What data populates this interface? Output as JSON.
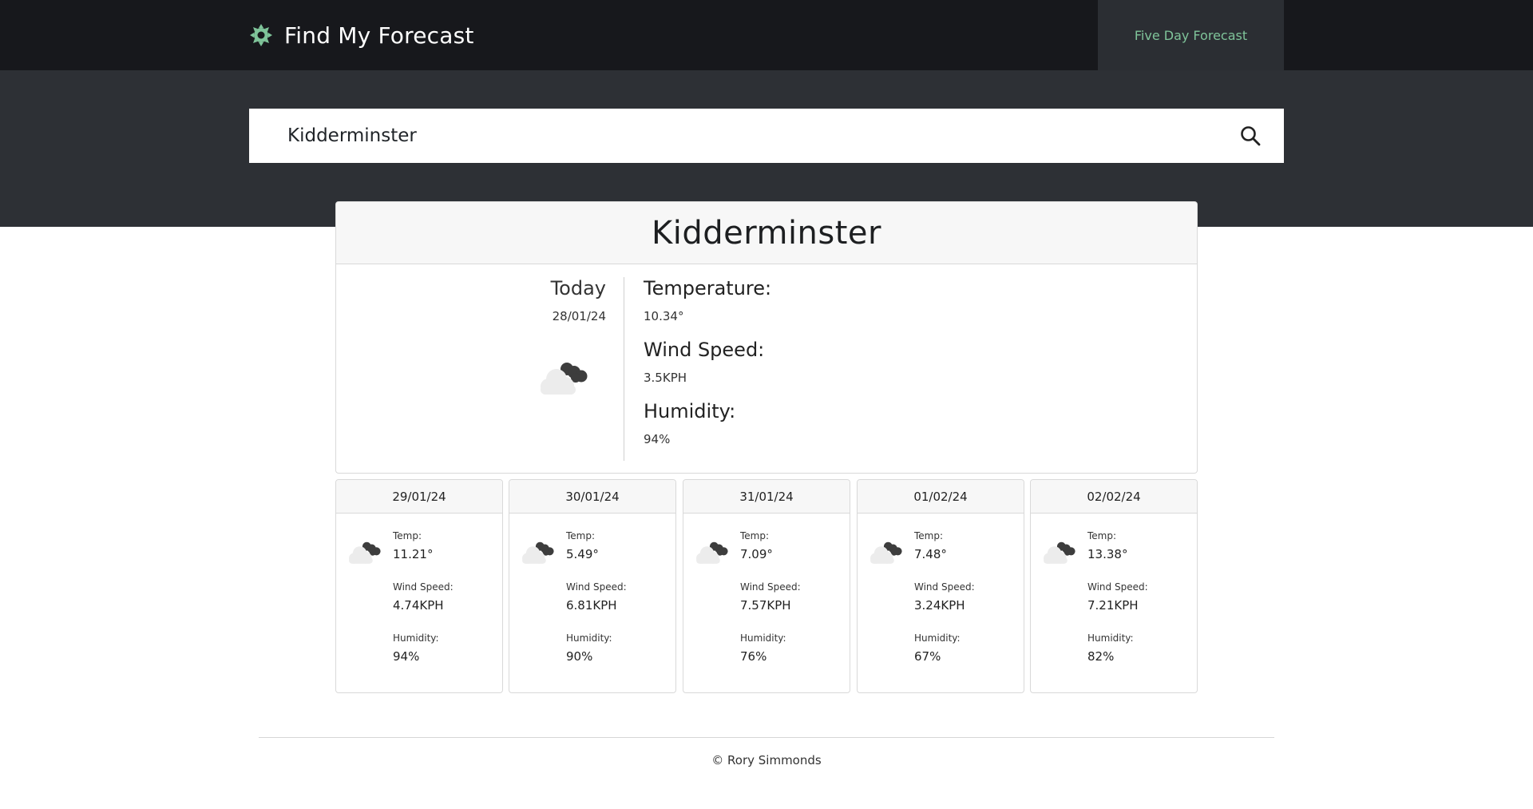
{
  "header": {
    "brand_icon": "sun-icon",
    "brand_title": "Find My Forecast",
    "nav_link": "Five Day Forecast",
    "accent_color": "#7fc49a"
  },
  "search": {
    "value": "Kidderminster",
    "placeholder": "",
    "button_icon": "search-icon"
  },
  "current": {
    "city": "Kidderminster",
    "day_label": "Today",
    "date": "28/01/24",
    "icon": "cloudy-icon",
    "temperature_label": "Temperature:",
    "temperature": "10.34°",
    "wind_label": "Wind Speed:",
    "wind": "3.5KPH",
    "humidity_label": "Humidity:",
    "humidity": "94%"
  },
  "forecast": [
    {
      "date": "29/01/24",
      "icon": "cloudy-icon",
      "temp_label": "Temp:",
      "temp": "11.21°",
      "wind_label": "Wind Speed:",
      "wind": "4.74KPH",
      "humidity_label": "Humidity:",
      "humidity": "94%"
    },
    {
      "date": "30/01/24",
      "icon": "cloudy-icon",
      "temp_label": "Temp:",
      "temp": "5.49°",
      "wind_label": "Wind Speed:",
      "wind": "6.81KPH",
      "humidity_label": "Humidity:",
      "humidity": "90%"
    },
    {
      "date": "31/01/24",
      "icon": "cloudy-icon",
      "temp_label": "Temp:",
      "temp": "7.09°",
      "wind_label": "Wind Speed:",
      "wind": "7.57KPH",
      "humidity_label": "Humidity:",
      "humidity": "76%"
    },
    {
      "date": "01/02/24",
      "icon": "cloudy-icon",
      "temp_label": "Temp:",
      "temp": "7.48°",
      "wind_label": "Wind Speed:",
      "wind": "3.24KPH",
      "humidity_label": "Humidity:",
      "humidity": "67%"
    },
    {
      "date": "02/02/24",
      "icon": "cloudy-icon",
      "temp_label": "Temp:",
      "temp": "13.38°",
      "wind_label": "Wind Speed:",
      "wind": "7.21KPH",
      "humidity_label": "Humidity:",
      "humidity": "82%"
    }
  ],
  "footer": {
    "copyright": "© Rory Simmonds"
  }
}
